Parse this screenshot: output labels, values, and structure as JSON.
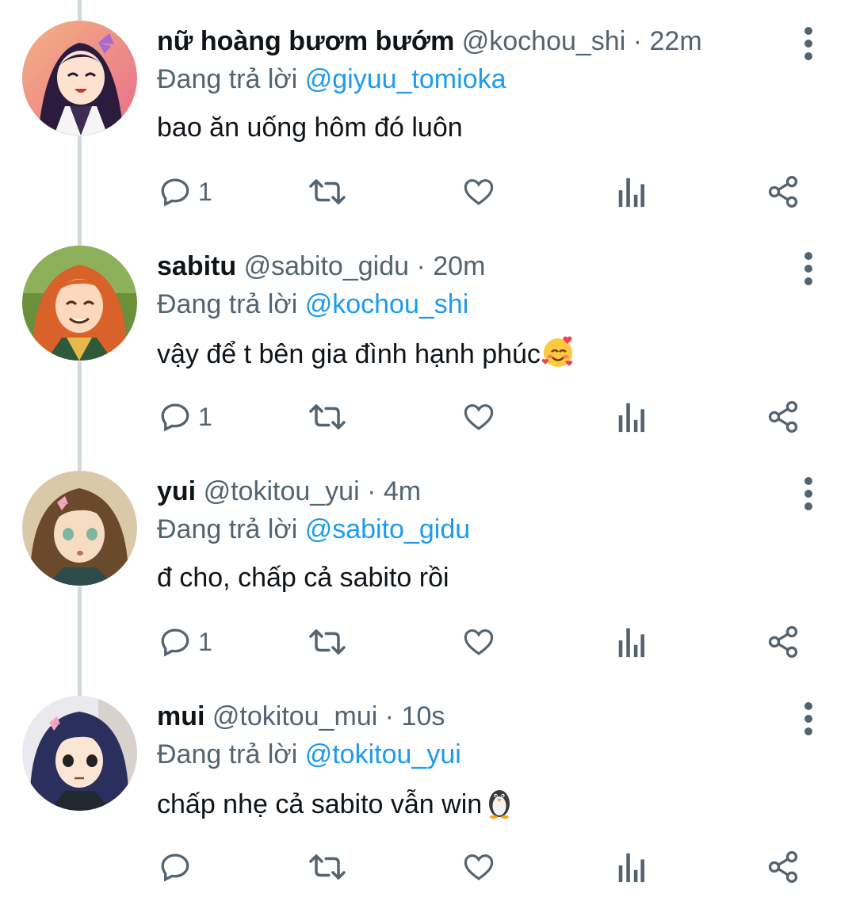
{
  "colors": {
    "text_primary": "#0f1419",
    "text_secondary": "#536471",
    "accent": "#1d9bf0",
    "icon": "#536471",
    "thread_line": "#cfd9de"
  },
  "tweets": [
    {
      "display_name": "nữ hoàng bươm bướm",
      "handle": "@kochou_shi",
      "separator": "·",
      "time": "22m",
      "reply_prefix": "Đang trả lời",
      "reply_to": "@giyuu_tomioka",
      "text": "bao ăn uống hôm đó luôn",
      "emoji": "",
      "reply_count": "1",
      "avatar_icon": "avatar-butterfly-girl"
    },
    {
      "display_name": "sabitu",
      "handle": "@sabito_gidu",
      "separator": "·",
      "time": "20m",
      "reply_prefix": "Đang trả lời",
      "reply_to": "@kochou_shi",
      "text": "vậy để t bên gia đình hạnh phúc",
      "emoji": "smiling-face-with-hearts",
      "reply_count": "1",
      "avatar_icon": "avatar-red-hair-boy"
    },
    {
      "display_name": "yui",
      "handle": "@tokitou_yui",
      "separator": "·",
      "time": "4m",
      "reply_prefix": "Đang trả lời",
      "reply_to": "@sabito_gidu",
      "text": "đ cho, chấp cả sabito rồi",
      "emoji": "",
      "reply_count": "1",
      "avatar_icon": "avatar-brown-hair-girl"
    },
    {
      "display_name": "mui",
      "handle": "@tokitou_mui",
      "separator": "·",
      "time": "10s",
      "reply_prefix": "Đang trả lời",
      "reply_to": "@tokitou_yui",
      "text": "chấp nhẹ cả sabito vẫn win",
      "emoji": "penguin",
      "reply_count": "",
      "avatar_icon": "avatar-dark-hair-girl"
    }
  ]
}
